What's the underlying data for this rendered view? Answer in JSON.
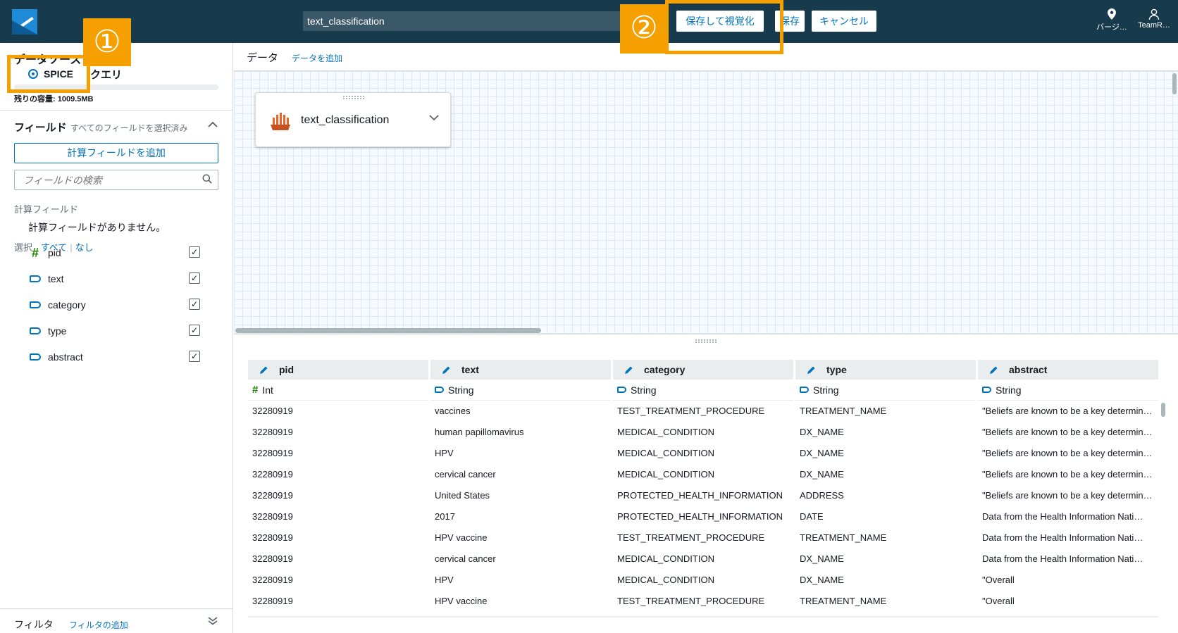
{
  "topbar": {
    "dataset_name": "text_classification",
    "save_visualize": "保存して視覚化",
    "save": "保存",
    "cancel": "キャンセル",
    "region_label": "バージ…",
    "user_label": "TeamR…"
  },
  "left": {
    "datasource_title": "データソース",
    "spice_label": "SPICE",
    "query_label": "クエリ",
    "capacity": "残りの容量: 1009.5MB",
    "fields_title": "フィールド",
    "fields_subtitle": "すべてのフィールドを選択済み",
    "add_calc_field": "計算フィールドを追加",
    "search_placeholder": "フィールドの検索",
    "calc_fields_label": "計算フィールド",
    "no_calc_fields": "計算フィールドがありません。",
    "select_label": "選択",
    "select_all": "すべて",
    "select_none": "なし",
    "fields": [
      {
        "name": "pid",
        "type": "int",
        "checked": true
      },
      {
        "name": "text",
        "type": "string",
        "checked": true
      },
      {
        "name": "category",
        "type": "string",
        "checked": true
      },
      {
        "name": "type",
        "type": "string",
        "checked": true
      },
      {
        "name": "abstract",
        "type": "string",
        "checked": true
      }
    ],
    "filter_title": "フィルタ",
    "filter_add": "フィルタの追加"
  },
  "main": {
    "data_label": "データ",
    "add_data": "データを追加",
    "node_label": "text_classification"
  },
  "table": {
    "columns": [
      {
        "name": "pid",
        "type": "Int"
      },
      {
        "name": "text",
        "type": "String"
      },
      {
        "name": "category",
        "type": "String"
      },
      {
        "name": "type",
        "type": "String"
      },
      {
        "name": "abstract",
        "type": "String"
      }
    ],
    "rows": [
      [
        "32280919",
        "vaccines",
        "TEST_TREATMENT_PROCEDURE",
        "TREATMENT_NAME",
        "\"Beliefs are known to be a key determin…"
      ],
      [
        "32280919",
        "human papillomavirus",
        "MEDICAL_CONDITION",
        "DX_NAME",
        "\"Beliefs are known to be a key determin…"
      ],
      [
        "32280919",
        "HPV",
        "MEDICAL_CONDITION",
        "DX_NAME",
        "\"Beliefs are known to be a key determin…"
      ],
      [
        "32280919",
        "cervical cancer",
        "MEDICAL_CONDITION",
        "DX_NAME",
        "\"Beliefs are known to be a key determin…"
      ],
      [
        "32280919",
        "United States",
        "PROTECTED_HEALTH_INFORMATION",
        "ADDRESS",
        "\"Beliefs are known to be a key determin…"
      ],
      [
        "32280919",
        "2017",
        "PROTECTED_HEALTH_INFORMATION",
        "DATE",
        "Data from the Health Information Nati…"
      ],
      [
        "32280919",
        "HPV vaccine",
        "TEST_TREATMENT_PROCEDURE",
        "TREATMENT_NAME",
        "Data from the Health Information Nati…"
      ],
      [
        "32280919",
        "cervical cancer",
        "MEDICAL_CONDITION",
        "DX_NAME",
        "Data from the Health Information Nati…"
      ],
      [
        "32280919",
        "HPV",
        "MEDICAL_CONDITION",
        "DX_NAME",
        "\"Overall"
      ],
      [
        "32280919",
        "HPV vaccine",
        "TEST_TREATMENT_PROCEDURE",
        "TREATMENT_NAME",
        "\"Overall"
      ]
    ]
  },
  "annotations": {
    "step1": "①",
    "step2": "②",
    "color": "#f5a000"
  }
}
